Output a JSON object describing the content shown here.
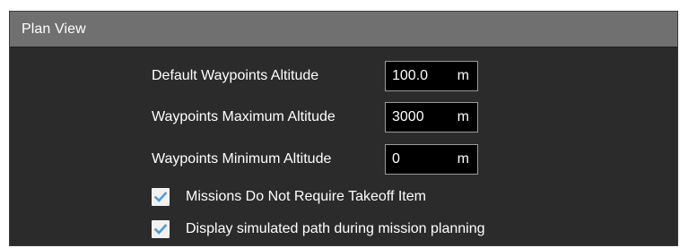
{
  "panel": {
    "title": "Plan View"
  },
  "settings": [
    {
      "label": "Default Waypoints Altitude",
      "value": "100.0",
      "unit": "m"
    },
    {
      "label": "Waypoints Maximum Altitude",
      "value": "3000",
      "unit": "m"
    },
    {
      "label": "Waypoints Minimum Altitude",
      "value": "0",
      "unit": "m"
    }
  ],
  "checkboxes": [
    {
      "label": "Missions Do Not Require Takeoff Item",
      "checked": true
    },
    {
      "label": "Display simulated path during mission planning",
      "checked": true
    }
  ],
  "colors": {
    "panel_background": "#2b2b2b",
    "header_background": "#707070",
    "field_background": "#000000",
    "checkmark": "#4a9ede"
  },
  "icons": [
    "checkmark-icon"
  ]
}
